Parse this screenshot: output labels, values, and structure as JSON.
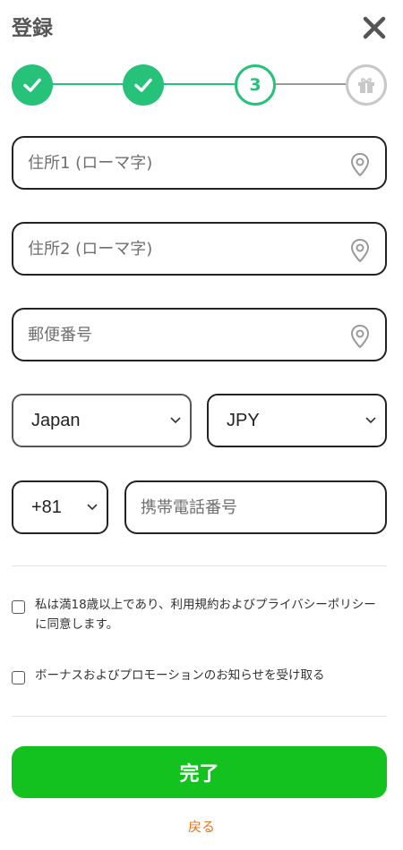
{
  "header": {
    "title": "登録",
    "close_icon": "close-icon"
  },
  "stepper": {
    "steps": [
      {
        "state": "done",
        "icon": "check-icon"
      },
      {
        "state": "done",
        "icon": "check-icon"
      },
      {
        "state": "current",
        "label": "3"
      },
      {
        "state": "pending",
        "icon": "gift-icon"
      }
    ],
    "accent_color": "#27c27a",
    "pending_color": "#c8c8c8"
  },
  "form": {
    "address1": {
      "value": "",
      "placeholder": "住所1 (ローマ字)",
      "icon": "location-pin-icon"
    },
    "address2": {
      "value": "",
      "placeholder": "住所2 (ローマ字)",
      "icon": "location-pin-icon"
    },
    "postal_code": {
      "value": "",
      "placeholder": "郵便番号",
      "icon": "location-pin-icon"
    },
    "country": {
      "selected": "Japan"
    },
    "currency": {
      "selected": "JPY"
    },
    "phone_code": {
      "selected": "+81"
    },
    "phone": {
      "value": "",
      "placeholder": "携帯電話番号"
    }
  },
  "consents": {
    "terms_label": "私は満18歳以上であり、利用規約およびプライバシーポリシーに同意します。",
    "terms_checked": false,
    "bonus_label": "ボーナスおよびプロモーションのお知らせを受け取る",
    "bonus_checked": false
  },
  "actions": {
    "submit_label": "完了",
    "submit_color": "#14c21f",
    "back_label": "戻る",
    "back_color": "#e8731d"
  }
}
